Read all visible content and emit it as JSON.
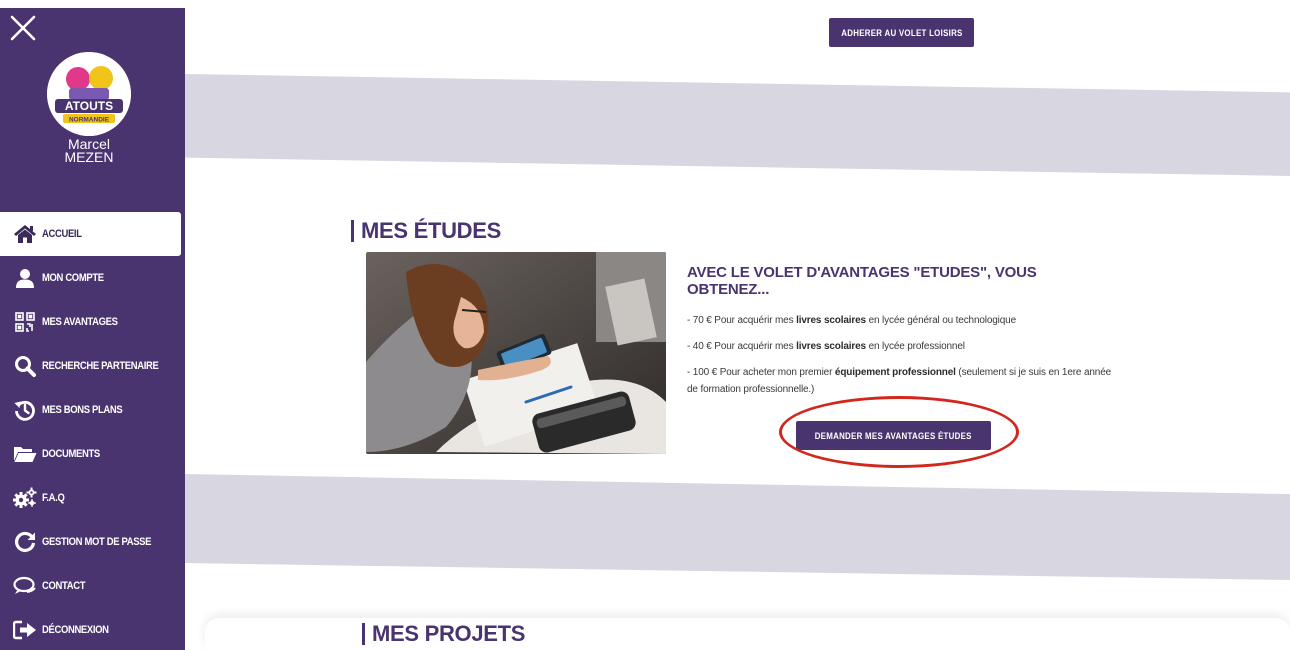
{
  "user": {
    "first_name": "Marcel",
    "last_name": "MEZEN"
  },
  "logo": {
    "text_main": "ATOUTS",
    "text_sub": "NORMANDIE"
  },
  "sidebar": {
    "items": [
      {
        "label": "ACCUEIL",
        "icon": "home-icon"
      },
      {
        "label": "MON COMPTE",
        "icon": "user-icon"
      },
      {
        "label": "MES AVANTAGES",
        "icon": "qr-code-icon"
      },
      {
        "label": "RECHERCHE PARTENAIRE",
        "icon": "search-icon"
      },
      {
        "label": "MES BONS PLANS",
        "icon": "history-icon"
      },
      {
        "label": "DOCUMENTS",
        "icon": "folder-icon"
      },
      {
        "label": "F.A.Q",
        "icon": "gears-icon"
      },
      {
        "label": "GESTION MOT DE PASSE",
        "icon": "refresh-icon"
      },
      {
        "label": "CONTACT",
        "icon": "chat-icon"
      },
      {
        "label": "DÉCONNEXION",
        "icon": "logout-icon"
      }
    ]
  },
  "buttons": {
    "loisirs": "ADHERER AU VOLET LOISIRS",
    "etudes": "DEMANDER MES AVANTAGES ÉTUDES"
  },
  "etudes": {
    "title": "MES ÉTUDES",
    "offer_title": "AVEC LE VOLET D'AVANTAGES \"ETUDES\", VOUS OBTENEZ...",
    "lines": [
      {
        "pre": "- 70 € Pour acquérir mes ",
        "bold": "livres scolaires",
        "post": " en lycée général ou technologique"
      },
      {
        "pre": "- 40 € Pour acquérir mes ",
        "bold": "livres scolaires",
        "post": " en lycée professionnel"
      },
      {
        "pre": "- 100 € Pour acheter mon premier ",
        "bold": "équipement professionnel",
        "post": " (seulement si je suis en 1ere année de formation professionnelle.)"
      }
    ]
  },
  "projets": {
    "title": "MES PROJETS"
  },
  "colors": {
    "primary": "#4a3470",
    "band": "#d8d7e1",
    "highlight": "#d0281c"
  }
}
